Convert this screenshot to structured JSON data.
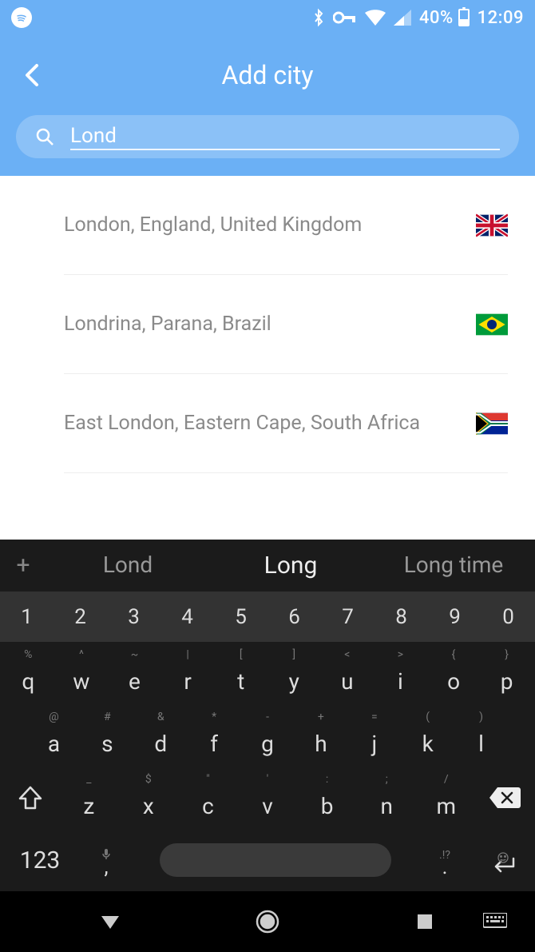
{
  "statusBar": {
    "batteryPercent": "40%",
    "time": "12:09"
  },
  "header": {
    "title": "Add city"
  },
  "search": {
    "value": "Lond",
    "placeholder": ""
  },
  "results": [
    {
      "label": "London, England, United Kingdom",
      "flag": "uk"
    },
    {
      "label": "Londrina, Parana, Brazil",
      "flag": "br"
    },
    {
      "label": "East London, Eastern Cape, South Africa",
      "flag": "za"
    }
  ],
  "keyboard": {
    "suggestions": [
      "Lond",
      "Long",
      "Long time"
    ],
    "activeSuggestionIndex": 1,
    "numRow": [
      "1",
      "2",
      "3",
      "4",
      "5",
      "6",
      "7",
      "8",
      "9",
      "0"
    ],
    "row1": [
      {
        "main": "q",
        "alt": "%"
      },
      {
        "main": "w",
        "alt": "^"
      },
      {
        "main": "e",
        "alt": "~"
      },
      {
        "main": "r",
        "alt": "|"
      },
      {
        "main": "t",
        "alt": "["
      },
      {
        "main": "y",
        "alt": "]"
      },
      {
        "main": "u",
        "alt": "<"
      },
      {
        "main": "i",
        "alt": ">"
      },
      {
        "main": "o",
        "alt": "{"
      },
      {
        "main": "p",
        "alt": "}"
      }
    ],
    "row2": [
      {
        "main": "a",
        "alt": "@"
      },
      {
        "main": "s",
        "alt": "#"
      },
      {
        "main": "d",
        "alt": "&"
      },
      {
        "main": "f",
        "alt": "*"
      },
      {
        "main": "g",
        "alt": "-"
      },
      {
        "main": "h",
        "alt": "+"
      },
      {
        "main": "j",
        "alt": "="
      },
      {
        "main": "k",
        "alt": "("
      },
      {
        "main": "l",
        "alt": ")"
      }
    ],
    "row3": [
      {
        "main": "z",
        "alt": "_"
      },
      {
        "main": "x",
        "alt": "$"
      },
      {
        "main": "c",
        "alt": "\""
      },
      {
        "main": "v",
        "alt": "'"
      },
      {
        "main": "b",
        "alt": ":"
      },
      {
        "main": "n",
        "alt": ";"
      },
      {
        "main": "m",
        "alt": "/"
      }
    ],
    "symKey": "123",
    "commaAlt": "🎤",
    "comma": ",",
    "periodAlt": ".!?",
    "period": ".",
    "enterAlt": "☺"
  }
}
